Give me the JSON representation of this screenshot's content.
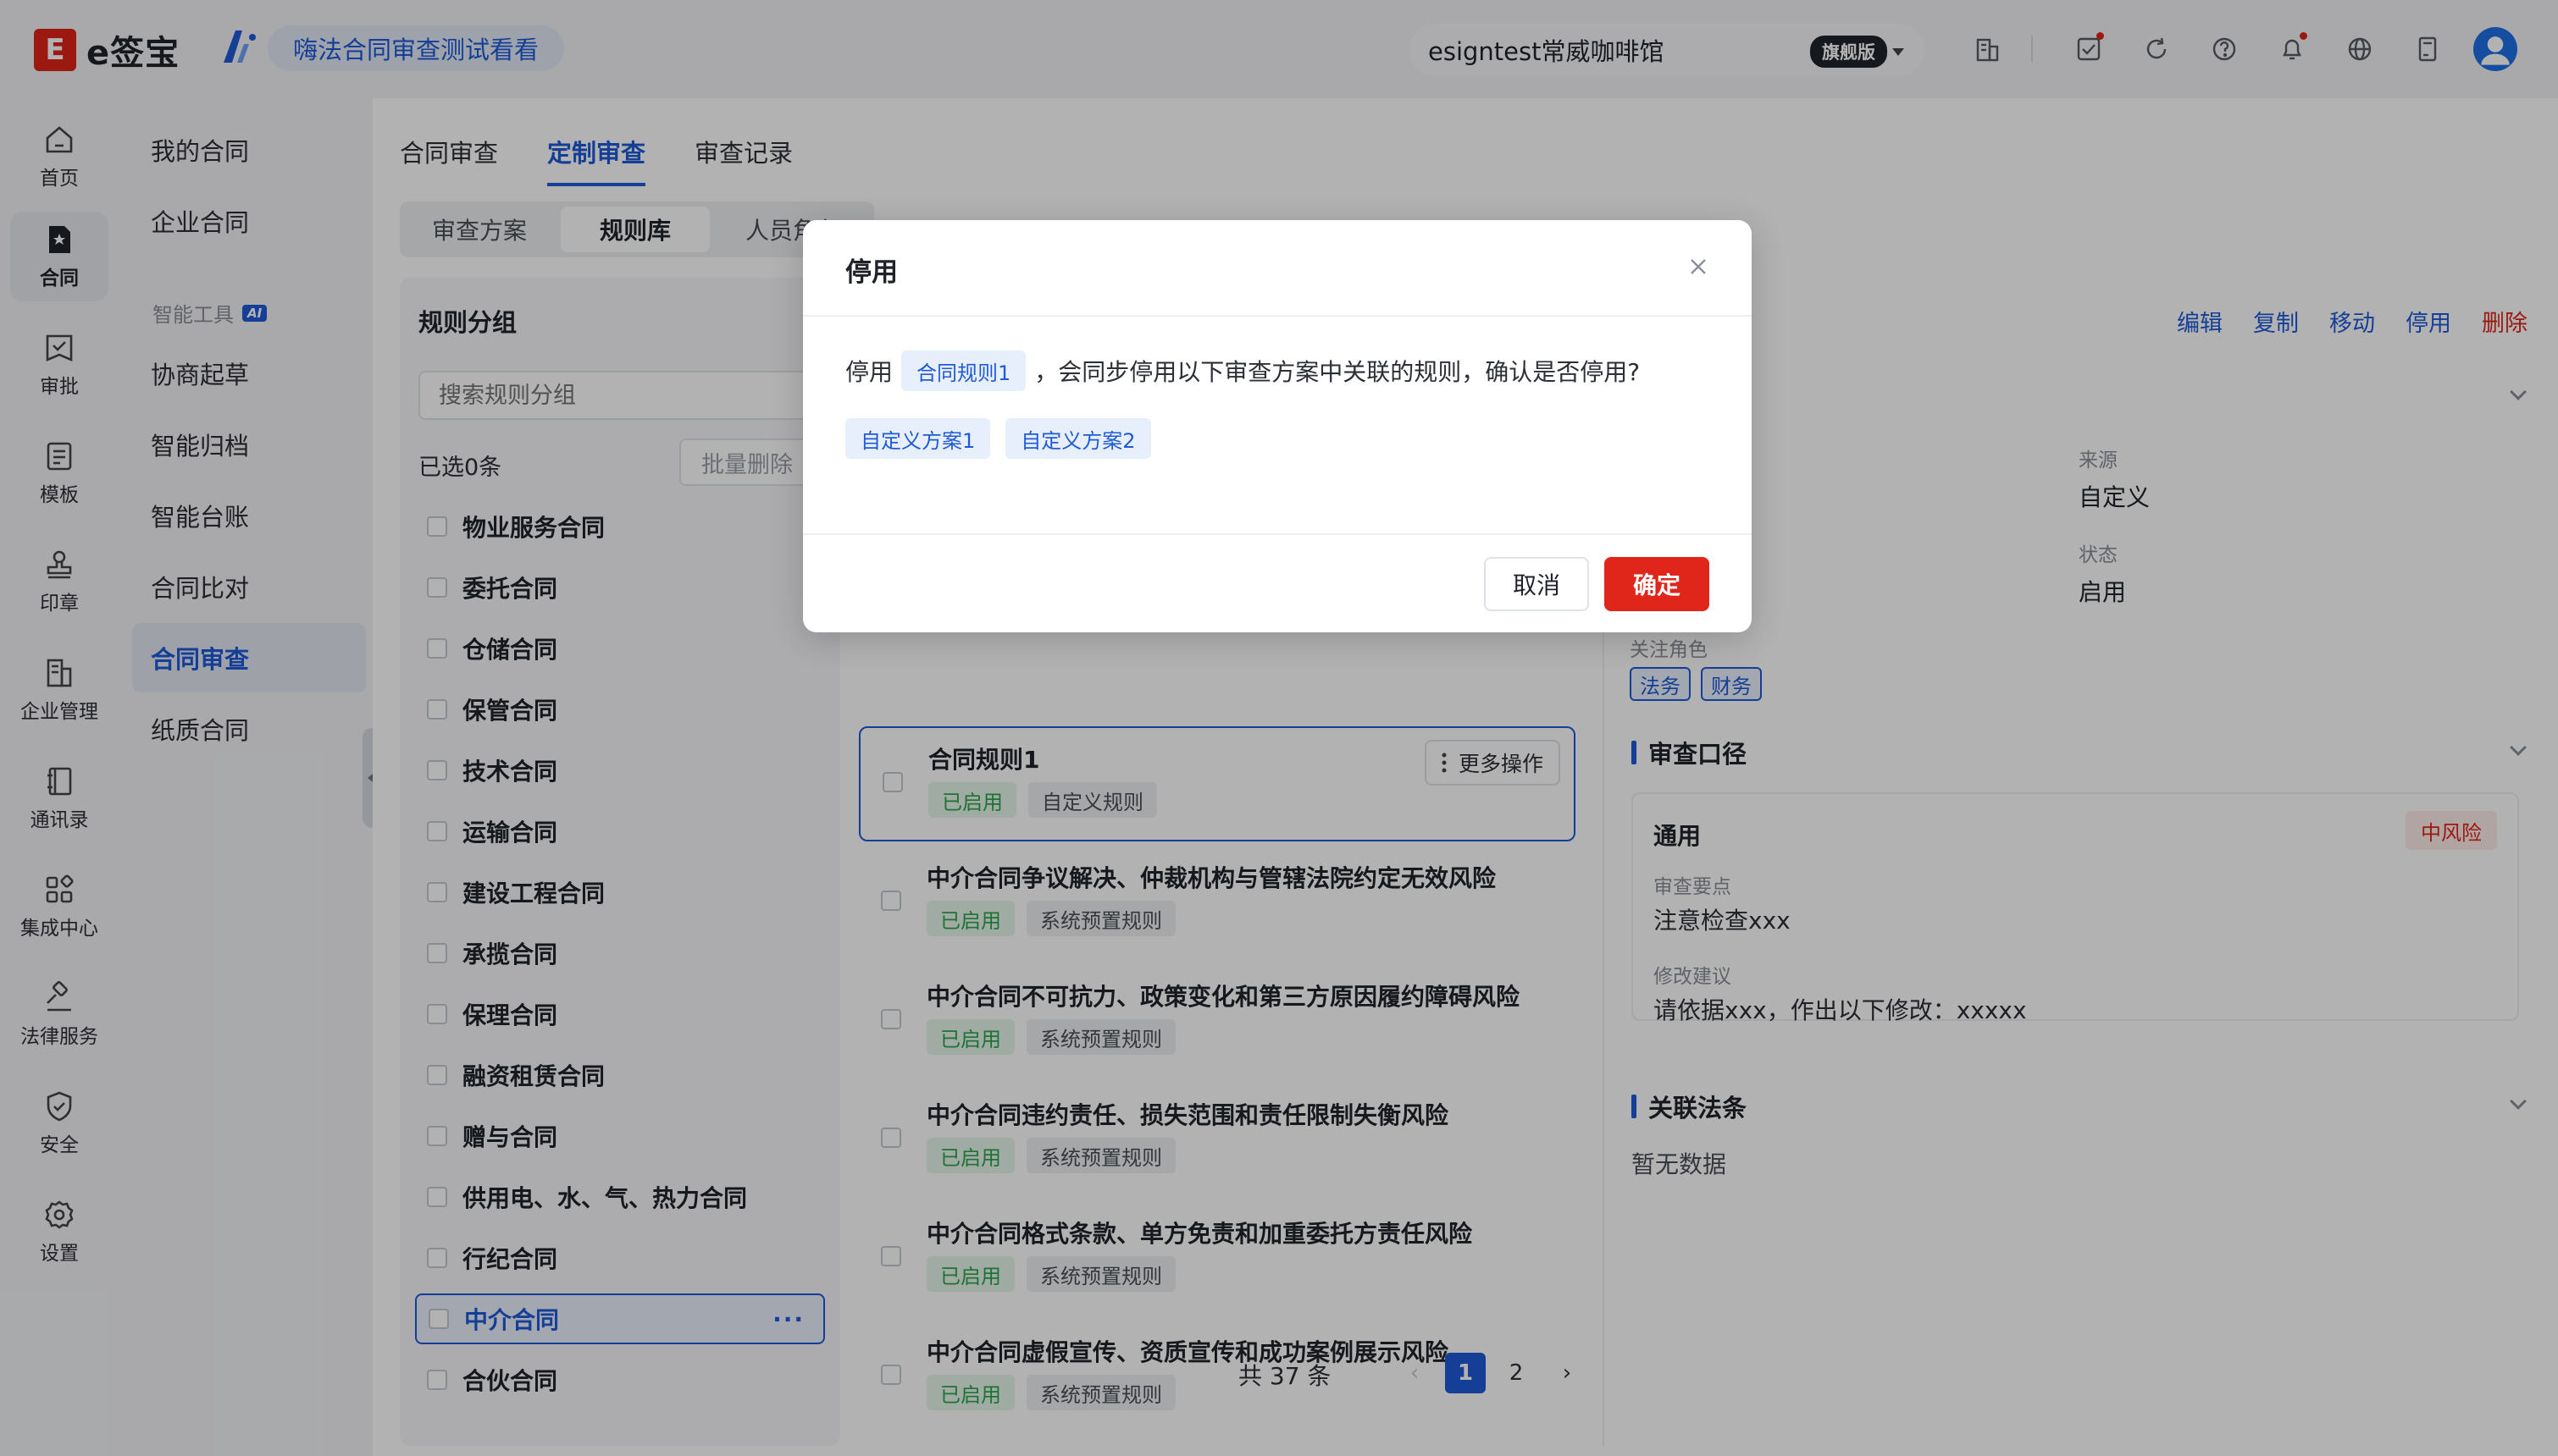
{
  "header": {
    "logo_text": "e签宝",
    "logo_mark": "E",
    "project_name": "嗨法合同审查测试看看",
    "company_name": "esigntest常威咖啡馆",
    "edition": "旗舰版",
    "icons": [
      "building-icon",
      "task-icon",
      "refresh-icon",
      "help-icon",
      "bell-icon",
      "globe-icon",
      "calculator-icon",
      "avatar"
    ]
  },
  "rail": {
    "items": [
      {
        "label": "首页",
        "icon": "home-icon"
      },
      {
        "label": "合同",
        "icon": "contract-icon"
      },
      {
        "label": "审批",
        "icon": "approval-icon"
      },
      {
        "label": "模板",
        "icon": "template-icon"
      },
      {
        "label": "印章",
        "icon": "seal-icon"
      },
      {
        "label": "企业管理",
        "icon": "enterprise-icon"
      },
      {
        "label": "通讯录",
        "icon": "contacts-icon"
      },
      {
        "label": "集成中心",
        "icon": "integration-icon"
      },
      {
        "label": "法律服务",
        "icon": "legal-icon"
      },
      {
        "label": "安全",
        "icon": "shield-icon"
      },
      {
        "label": "设置",
        "icon": "gear-icon"
      }
    ]
  },
  "subnav": {
    "items": [
      "我的合同",
      "企业合同"
    ],
    "group_label": "智能工具",
    "ai_badge": "AI",
    "tools": [
      "协商起草",
      "智能归档",
      "智能台账",
      "合同比对",
      "合同审查",
      "纸质合同"
    ]
  },
  "tabs": [
    "合同审查",
    "定制审查",
    "审查记录"
  ],
  "segments": [
    "审查方案",
    "规则库",
    "人员角色"
  ],
  "groups": {
    "title": "规则分组",
    "search_placeholder": "搜索规则分组",
    "selected": "已选0条",
    "batch_delete": "批量删除",
    "items": [
      "物业服务合同",
      "委托合同",
      "仓储合同",
      "保管合同",
      "技术合同",
      "运输合同",
      "建设工程合同",
      "承揽合同",
      "保理合同",
      "融资租赁合同",
      "赠与合同",
      "供用电、水、气、热力合同",
      "行纪合同",
      "中介合同",
      "合伙合同"
    ],
    "more": "···"
  },
  "rules": {
    "items": [
      {
        "name": "合同规则1",
        "status": "已启用",
        "type": "自定义规则"
      },
      {
        "name": "中介合同争议解决、仲裁机构与管辖法院约定无效风险",
        "status": "已启用",
        "type": "系统预置规则"
      },
      {
        "name": "中介合同不可抗力、政策变化和第三方原因履约障碍风险",
        "status": "已启用",
        "type": "系统预置规则"
      },
      {
        "name": "中介合同违约责任、损失范围和责任限制失衡风险",
        "status": "已启用",
        "type": "系统预置规则"
      },
      {
        "name": "中介合同格式条款、单方免责和加重委托方责任风险",
        "status": "已启用",
        "type": "系统预置规则"
      },
      {
        "name": "中介合同虚假宣传、资质宣传和成功案例展示风险",
        "status": "已启用",
        "type": "系统预置规则"
      }
    ],
    "more_op": "更多操作",
    "total": "共 37 条",
    "pages": [
      "1",
      "2"
    ]
  },
  "detail": {
    "actions": [
      "编辑",
      "复制",
      "移动",
      "停用",
      "删除"
    ],
    "source_label": "来源",
    "source_value": "自定义",
    "status_label": "状态",
    "status_value": "启用",
    "roles_label": "关注角色",
    "roles": [
      "法务",
      "财务"
    ],
    "review_title": "审查口径",
    "review_scope": "通用",
    "risk": "中风险",
    "points_label": "审查要点",
    "points_value": "注意检查xxx",
    "suggest_label": "修改建议",
    "suggest_value": "请依据xxx，作出以下修改：xxxxx",
    "laws_title": "关联法条",
    "laws_empty": "暂无数据"
  },
  "dialog": {
    "title": "停用",
    "msg_prefix": "停用",
    "rule_chip": "合同规则1",
    "msg_suffix": "，会同步停用以下审查方案中关联的规则，确认是否停用?",
    "plans": [
      "自定义方案1",
      "自定义方案2"
    ],
    "cancel": "取消",
    "confirm": "确定"
  },
  "colors": {
    "accent": "#1f5bd8",
    "danger": "#e0251a",
    "success": "#2da44e"
  }
}
